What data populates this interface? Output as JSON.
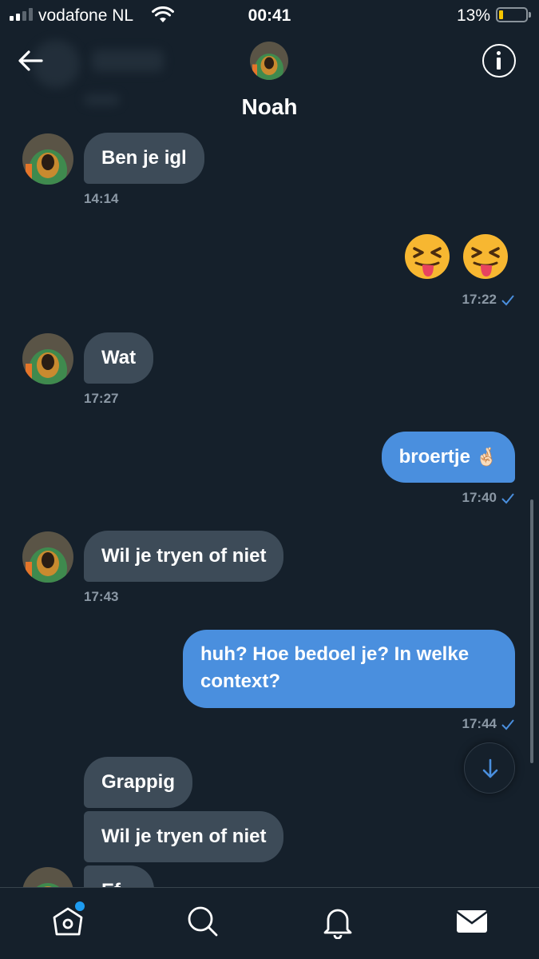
{
  "status_bar": {
    "carrier": "vodafone NL",
    "time": "00:41",
    "battery_percent": "13%",
    "battery_level": 0.13,
    "signal_bars": 2
  },
  "header": {
    "title": "Noah",
    "back_icon": "arrow-left-icon",
    "info_icon": "info-icon"
  },
  "messages": [
    {
      "direction": "in",
      "text": "Ben je igl",
      "time": "14:14"
    },
    {
      "direction": "out",
      "emoji": [
        "squinting-face-with-tongue",
        "squinting-face-with-tongue"
      ],
      "time": "17:22",
      "read": true
    },
    {
      "direction": "in",
      "text": "Wat",
      "time": "17:27"
    },
    {
      "direction": "out",
      "text": "broertje",
      "emoji_suffix": "🤞🏻",
      "time": "17:40",
      "read": true
    },
    {
      "direction": "in",
      "text": "Wil je tryen of niet",
      "time": "17:43"
    },
    {
      "direction": "out",
      "lines": [
        "huh? Hoe bedoel je? In welke",
        "context?"
      ],
      "time": "17:44",
      "read": true
    },
    {
      "direction": "in",
      "text": "Grappig"
    },
    {
      "direction": "in",
      "text": "Wil je tryen of niet"
    },
    {
      "direction": "in",
      "text": "Ef..."
    }
  ],
  "bottom_nav": {
    "items": [
      "home-icon",
      "search-icon",
      "bell-icon",
      "mail-icon"
    ],
    "active": "mail-icon",
    "accent": "#1d9bf0"
  },
  "colors": {
    "background": "#15202b",
    "incoming_bubble": "#3d4b58",
    "outgoing_bubble": "#4a8fde",
    "timestamp": "#8b98a5"
  }
}
